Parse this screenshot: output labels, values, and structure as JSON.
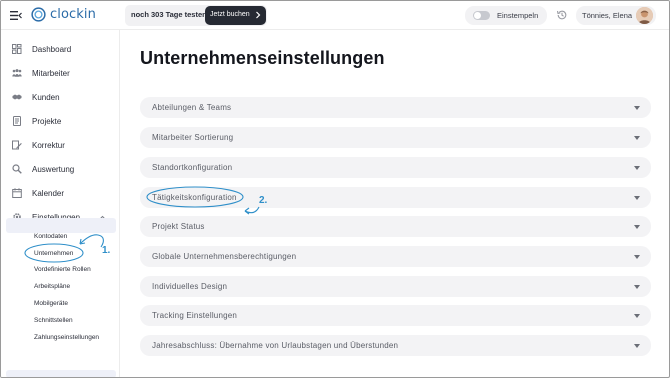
{
  "app": {
    "name": "clockin",
    "brand_color": "#2b6ca8"
  },
  "topbar": {
    "trial_text": "noch 303 Tage testen",
    "trial_button": "Jetzt buchen",
    "clock_in_label": "Einstempeln",
    "user_name": "Tönnies, Elena"
  },
  "sidebar": {
    "items": [
      {
        "label": "Dashboard",
        "icon": "dashboard-icon"
      },
      {
        "label": "Mitarbeiter",
        "icon": "employees-icon"
      },
      {
        "label": "Kunden",
        "icon": "handshake-icon"
      },
      {
        "label": "Projekte",
        "icon": "projects-icon"
      },
      {
        "label": "Korrektur",
        "icon": "edit-icon"
      },
      {
        "label": "Auswertung",
        "icon": "search-icon"
      },
      {
        "label": "Kalender",
        "icon": "calendar-icon"
      },
      {
        "label": "Einstellungen",
        "icon": "gear-icon"
      }
    ],
    "subitems": [
      "Kontodaten",
      "Unternehmen",
      "Vordefinierte Rollen",
      "Arbeitspläne",
      "Mobilgeräte",
      "Schnittstellen",
      "Zahlungseinstellungen"
    ],
    "active_subitem": "Unternehmen"
  },
  "main": {
    "title": "Unternehmenseinstellungen",
    "sections": [
      "Abteilungen & Teams",
      "Mitarbeiter Sortierung",
      "Standortkonfiguration",
      "Tätigkeitskonfiguration",
      "Projekt Status",
      "Globale Unternehmensberechtigungen",
      "Individuelles Design",
      "Tracking Einstellungen",
      "Jahresabschluss: Übernahme von Urlaubstagen und Überstunden"
    ]
  },
  "annotations": {
    "step1": "1.",
    "step2": "2.",
    "color": "#2f8fc9"
  }
}
